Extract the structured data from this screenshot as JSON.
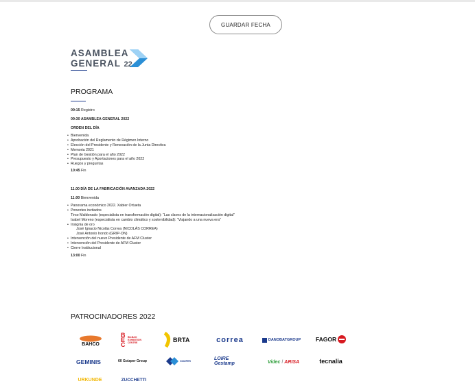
{
  "button": {
    "label": "GUARDAR FECHA"
  },
  "logo": {
    "line1": "ASAMBLEA",
    "line2": "GENERAL",
    "num": "22"
  },
  "programa": {
    "title": "PROGRAMA",
    "t1_time": "09:15",
    "t1_text": "Registro",
    "t2": "09:30 ASAMBLEA GENERAL 2022",
    "orden": "ORDEN DEL DÍA",
    "orden_items": [
      "Bienvenida",
      "Aprobación del Reglamento de Régimen Interno",
      "Elección del Presidente y Renovación de la Junta Directiva",
      "Memoria 2021",
      "Plan de Gestión para el año 2022",
      "Presupuesto y Aportaciones para el año 2022",
      "Ruegos y preguntas"
    ],
    "t3_time": "10:45",
    "t3_text": "Fin",
    "t4": "11.00 DÍA DE LA FABRICACIÓN AVANZADA 2022",
    "t5_time": "11:00",
    "t5_text": "Bienvenida",
    "dia_items": [
      {
        "text": "Panorama económico 2022. Xabier Ortueta",
        "bullet": true
      },
      {
        "text": "Ponentes invitados",
        "bullet": true
      },
      {
        "text": "Tirso Maldonado (especialista en transformación digital): “Las claves de la internacionalización digital”",
        "bullet": false
      },
      {
        "text": "Isabel Moreno (especialista en cambio climático y sostenibilidad): “Viajando a una nueva era”",
        "bullet": false
      },
      {
        "text": "Insignia de oro",
        "bullet": true
      },
      {
        "text": "José Ignacio Nicolás Correa (NICOLÁS CORREA)",
        "bullet": false,
        "indent": true
      },
      {
        "text": "José Antonio Irondo (GRIP-ON)",
        "bullet": false,
        "indent": true
      },
      {
        "text": "Intervención del nuevo Presidente de AFM Cluster",
        "bullet": true
      },
      {
        "text": "Intervención del Presidente de AFM Cluster",
        "bullet": true
      },
      {
        "text": "Cierre Institucional",
        "bullet": true
      }
    ],
    "t6_time": "13:00",
    "t6_text": "Fin"
  },
  "patrocinadores": {
    "title": "PATROCINADORES 2022",
    "logos": [
      "BAHCO",
      "BILBAO EXHIBITION CENTRE",
      "BRTA",
      "correa",
      "DANOBATGROUP",
      "FAGOR",
      "GEMINIS",
      "60 Goizper Group",
      "GOIZPER",
      "LOIRE Gestamp",
      "Videc",
      "ARISA",
      "tecnalia",
      "URKUNDE",
      "ZUCCHETTI"
    ],
    "colors": {
      "accent": "#1b3a8c",
      "fagor_red": "#d71920",
      "urkunde": "#f2b705"
    }
  }
}
